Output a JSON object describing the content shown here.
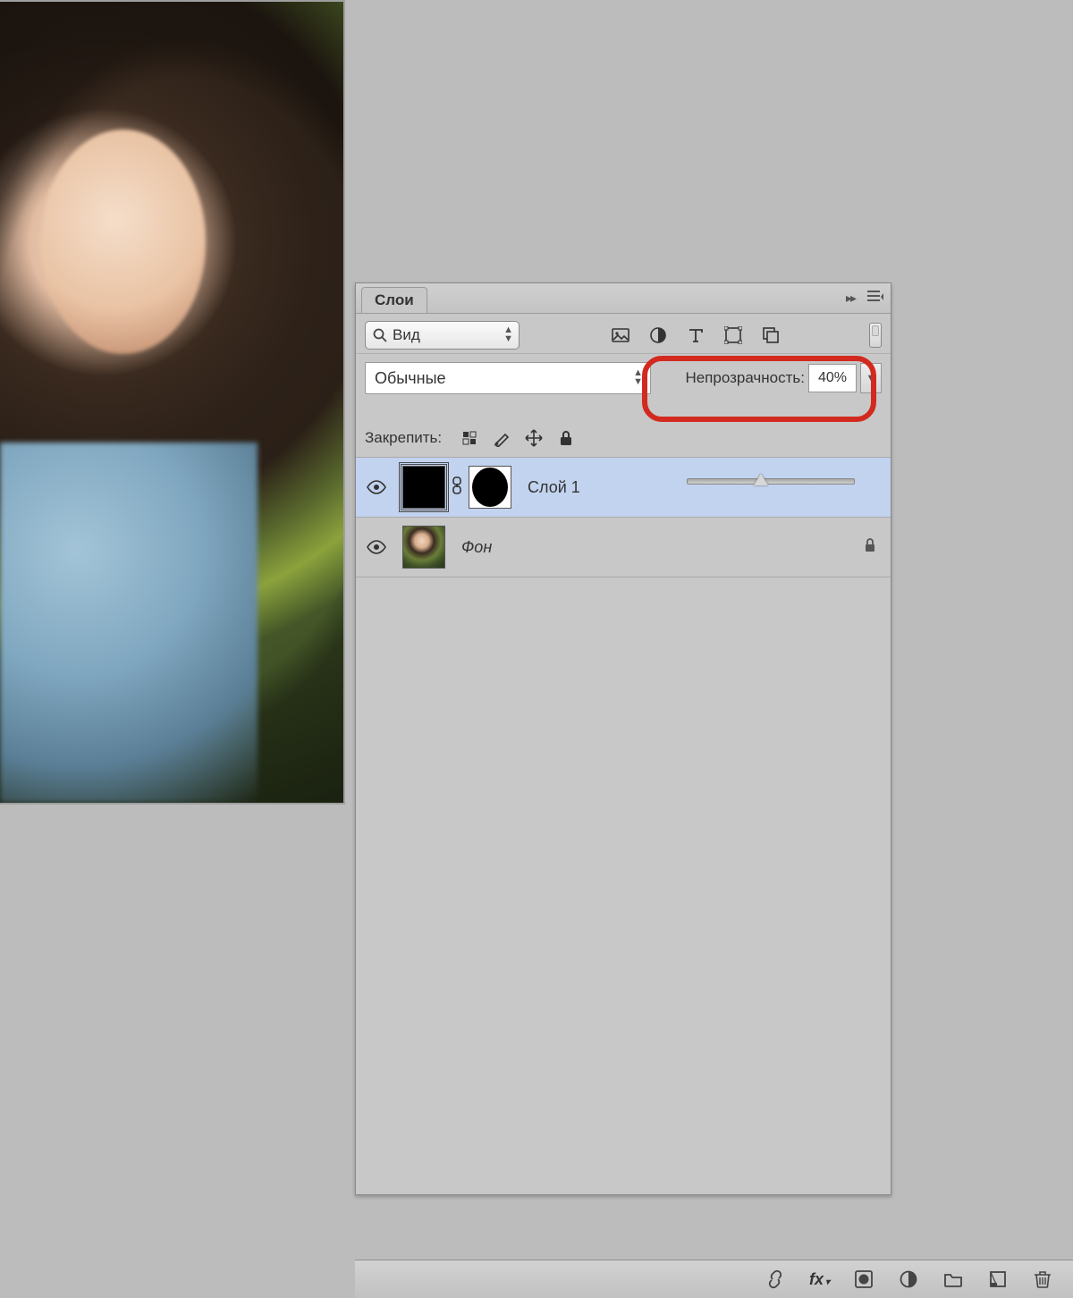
{
  "panel": {
    "title": "Слои",
    "kind_select": "Вид",
    "blend_mode": "Обычные",
    "opacity_label": "Непрозрачность:",
    "opacity_value": "40%",
    "opacity_percent": 40,
    "lock_label": "Закрепить:",
    "filter_icons": [
      "pixel",
      "adjustment",
      "type",
      "shape",
      "smart"
    ]
  },
  "layers": [
    {
      "name": "Слой 1",
      "visible": true,
      "selected": true,
      "has_mask": true,
      "locked": false,
      "italic": false
    },
    {
      "name": "Фон",
      "visible": true,
      "selected": false,
      "has_mask": false,
      "locked": true,
      "italic": true
    }
  ],
  "bottom_bar": {
    "icons": [
      "link",
      "fx",
      "mask",
      "adjustment",
      "group",
      "create",
      "delete"
    ]
  }
}
